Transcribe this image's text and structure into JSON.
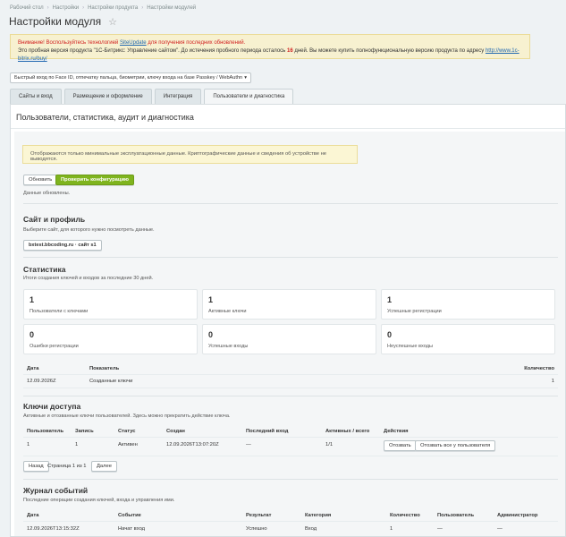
{
  "breadcrumbs": [
    "Рабочий стол",
    "Настройки",
    "Настройки продукта",
    "Настройки модулей"
  ],
  "page_title": "Настройки модуля",
  "alert": {
    "prefix": "Внимание! Воспользуйтесь технологией ",
    "link1": "SiteUpdate",
    "suffix1": " для получения последних обновлений.",
    "line2a": "Это пробная версия продукта \"1С-Битрикс: Управление сайтом\". До истечения пробного периода осталось ",
    "days": "16",
    "line2b": " дней. Вы можете купить полнофункциональную версию продукта по адресу ",
    "link2": "http://www.1c-bitrix.ru/buy/"
  },
  "module_select": {
    "value": "Быстрый вход по Face ID, отпечатку пальца, биометрии, ключу входа на базе Passkey / WebAuthn"
  },
  "tabs": [
    {
      "label": "Сайты и вход",
      "active": false
    },
    {
      "label": "Размещение и оформление",
      "active": false
    },
    {
      "label": "Интеграция",
      "active": false
    },
    {
      "label": "Пользователи и диагностика",
      "active": true
    }
  ],
  "panel_title": "Пользователи, статистика, аудит и диагностика",
  "notice": "Отображаются только минимальные эксплуатационные данные. Криптографические данные и сведения об устройстве не выводятся.",
  "buttons": {
    "refresh": "Обновить",
    "check_config": "Проверить конфигурацию"
  },
  "status_msg": "Данные обновлены.",
  "site_section": {
    "title": "Сайт и профиль",
    "desc": "Выберите сайт, для которого нужно посмотреть данные.",
    "site_button": "bxtest.bbcoding.ru · сайт s1"
  },
  "stats": {
    "title": "Статистика",
    "desc": "Итоги создания ключей и входов за последние 30 дней.",
    "cards": [
      {
        "value": "1",
        "label": "Пользователи с ключами"
      },
      {
        "value": "1",
        "label": "Активные ключи"
      },
      {
        "value": "1",
        "label": "Успешные регистрации"
      },
      {
        "value": "0",
        "label": "Ошибки регистрации"
      },
      {
        "value": "0",
        "label": "Успешные входы"
      },
      {
        "value": "0",
        "label": "Неуспешные входы"
      }
    ],
    "table": {
      "headers": {
        "date": "Дата",
        "metric": "Показатель",
        "count": "Количество"
      },
      "rows": [
        {
          "date": "12.09.2026Z",
          "metric": "Созданные ключи",
          "count": "1"
        }
      ]
    }
  },
  "keys": {
    "title": "Ключи доступа",
    "desc": "Активные и отозванные ключи пользователей. Здесь можно прекратить действие ключа.",
    "headers": {
      "user": "Пользователь",
      "record": "Запись",
      "status": "Статус",
      "created": "Создан",
      "last_login": "Последний вход",
      "active_total": "Активных / всего",
      "actions": "Действия"
    },
    "rows": [
      {
        "user": "1",
        "record": "1",
        "status": "Активен",
        "created": "12.09.2026T13:07:20Z",
        "last_login": "—",
        "active_total": "1/1",
        "revoke": "Отозвать",
        "revoke_all": "Отозвать все у пользователя"
      }
    ],
    "pager": {
      "prev": "Назад",
      "info": "Страница 1 из 1",
      "next": "Далее"
    }
  },
  "journal": {
    "title": "Журнал событий",
    "desc": "Последние операции создания ключей, входа и управления ими.",
    "headers": {
      "date": "Дата",
      "event": "Событие",
      "result": "Результат",
      "category": "Категория",
      "count": "Количество",
      "user": "Пользователь",
      "admin": "Администратор"
    },
    "rows": [
      {
        "date": "12.09.2026T13:15:32Z",
        "event": "Начат вход",
        "result": "Успешно",
        "category": "Вход",
        "count": "1",
        "user": "—",
        "admin": "—"
      }
    ]
  }
}
